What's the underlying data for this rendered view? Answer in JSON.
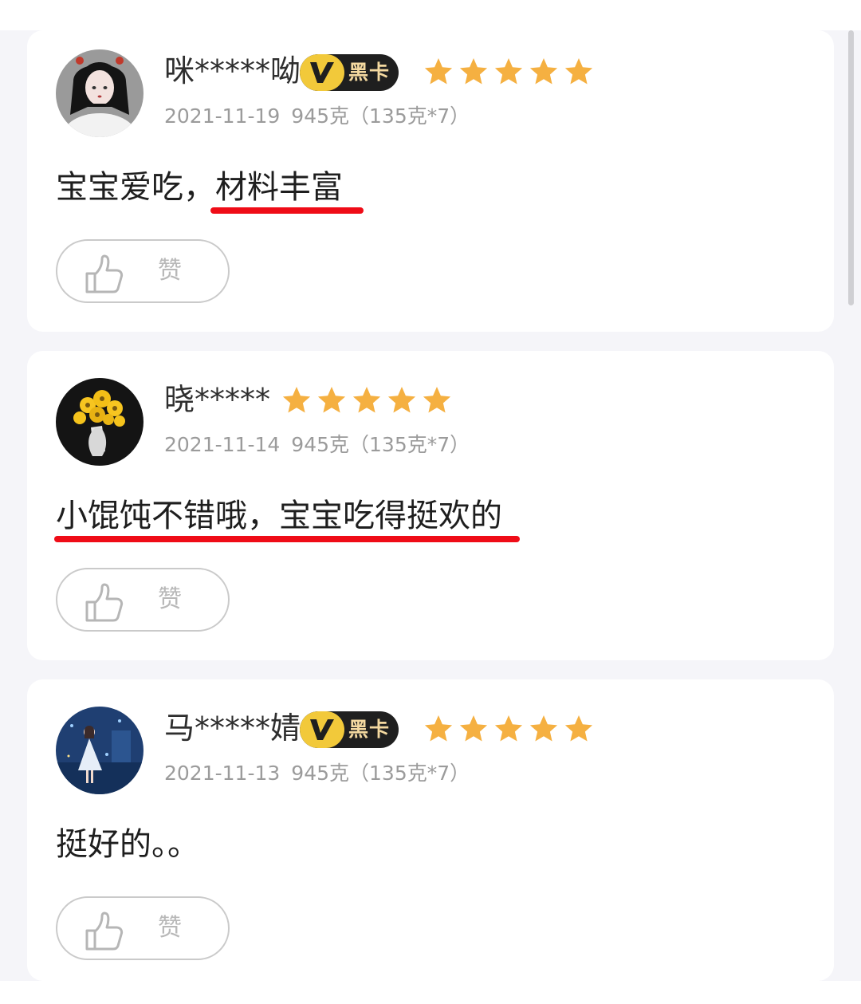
{
  "reviews": [
    {
      "username": "咪*****呦",
      "badge": {
        "letter": "V",
        "label": "黑卡"
      },
      "rating": 5,
      "date": "2021-11-19",
      "spec": "945克（135克*7）",
      "text": "宝宝爱吃，材料丰富",
      "text_plain": "宝宝爱吃，",
      "text_underlined": "材料丰富",
      "like_label": "赞"
    },
    {
      "username": "晓*****",
      "rating": 5,
      "date": "2021-11-14",
      "spec": "945克（135克*7）",
      "text": "小馄饨不错哦，宝宝吃得挺欢的",
      "text_underlined": "小馄饨不错哦，宝宝吃得挺欢的",
      "like_label": "赞"
    },
    {
      "username": "马*****婧",
      "badge": {
        "letter": "V",
        "label": "黑卡"
      },
      "rating": 5,
      "date": "2021-11-13",
      "spec": "945克（135克*7）",
      "text": "挺好的。。",
      "like_label": "赞"
    }
  ],
  "colors": {
    "star": "#f5b041",
    "underline": "#ef0c17",
    "badge_bg": "#1f1f1f",
    "badge_v": "#f2c93a",
    "meta_text": "#9b9b9b",
    "page_bg": "#f5f5f9"
  },
  "icons": [
    "star-icon",
    "thumbs-up-icon",
    "vip-v-icon"
  ]
}
